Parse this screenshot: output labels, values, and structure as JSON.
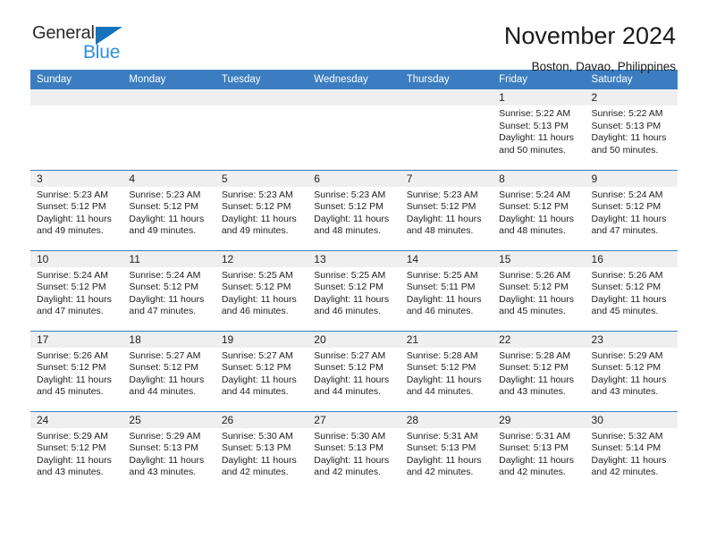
{
  "brand": {
    "name_part1": "General",
    "name_part2": "Blue",
    "triangle_icon": "triangle-icon",
    "accent_blue": "#2e8fd8",
    "dark_text": "#2b2b2b"
  },
  "header": {
    "title": "November 2024",
    "subtitle": "Boston, Davao, Philippines"
  },
  "colors": {
    "header_row_blue": "#3b7dc0",
    "daynum_strip": "#efefef",
    "cell_background": "#ffffff"
  },
  "calendar": {
    "weekdays": [
      "Sunday",
      "Monday",
      "Tuesday",
      "Wednesday",
      "Thursday",
      "Friday",
      "Saturday"
    ],
    "weeks": [
      [
        {
          "day": "",
          "empty": true,
          "sunrise": "",
          "sunset": "",
          "daylight1": "",
          "daylight2": ""
        },
        {
          "day": "",
          "empty": true,
          "sunrise": "",
          "sunset": "",
          "daylight1": "",
          "daylight2": ""
        },
        {
          "day": "",
          "empty": true,
          "sunrise": "",
          "sunset": "",
          "daylight1": "",
          "daylight2": ""
        },
        {
          "day": "",
          "empty": true,
          "sunrise": "",
          "sunset": "",
          "daylight1": "",
          "daylight2": ""
        },
        {
          "day": "",
          "empty": true,
          "sunrise": "",
          "sunset": "",
          "daylight1": "",
          "daylight2": ""
        },
        {
          "day": "1",
          "empty": false,
          "sunrise": "Sunrise: 5:22 AM",
          "sunset": "Sunset: 5:13 PM",
          "daylight1": "Daylight: 11 hours",
          "daylight2": "and 50 minutes."
        },
        {
          "day": "2",
          "empty": false,
          "sunrise": "Sunrise: 5:22 AM",
          "sunset": "Sunset: 5:13 PM",
          "daylight1": "Daylight: 11 hours",
          "daylight2": "and 50 minutes."
        }
      ],
      [
        {
          "day": "3",
          "empty": false,
          "sunrise": "Sunrise: 5:23 AM",
          "sunset": "Sunset: 5:12 PM",
          "daylight1": "Daylight: 11 hours",
          "daylight2": "and 49 minutes."
        },
        {
          "day": "4",
          "empty": false,
          "sunrise": "Sunrise: 5:23 AM",
          "sunset": "Sunset: 5:12 PM",
          "daylight1": "Daylight: 11 hours",
          "daylight2": "and 49 minutes."
        },
        {
          "day": "5",
          "empty": false,
          "sunrise": "Sunrise: 5:23 AM",
          "sunset": "Sunset: 5:12 PM",
          "daylight1": "Daylight: 11 hours",
          "daylight2": "and 49 minutes."
        },
        {
          "day": "6",
          "empty": false,
          "sunrise": "Sunrise: 5:23 AM",
          "sunset": "Sunset: 5:12 PM",
          "daylight1": "Daylight: 11 hours",
          "daylight2": "and 48 minutes."
        },
        {
          "day": "7",
          "empty": false,
          "sunrise": "Sunrise: 5:23 AM",
          "sunset": "Sunset: 5:12 PM",
          "daylight1": "Daylight: 11 hours",
          "daylight2": "and 48 minutes."
        },
        {
          "day": "8",
          "empty": false,
          "sunrise": "Sunrise: 5:24 AM",
          "sunset": "Sunset: 5:12 PM",
          "daylight1": "Daylight: 11 hours",
          "daylight2": "and 48 minutes."
        },
        {
          "day": "9",
          "empty": false,
          "sunrise": "Sunrise: 5:24 AM",
          "sunset": "Sunset: 5:12 PM",
          "daylight1": "Daylight: 11 hours",
          "daylight2": "and 47 minutes."
        }
      ],
      [
        {
          "day": "10",
          "empty": false,
          "sunrise": "Sunrise: 5:24 AM",
          "sunset": "Sunset: 5:12 PM",
          "daylight1": "Daylight: 11 hours",
          "daylight2": "and 47 minutes."
        },
        {
          "day": "11",
          "empty": false,
          "sunrise": "Sunrise: 5:24 AM",
          "sunset": "Sunset: 5:12 PM",
          "daylight1": "Daylight: 11 hours",
          "daylight2": "and 47 minutes."
        },
        {
          "day": "12",
          "empty": false,
          "sunrise": "Sunrise: 5:25 AM",
          "sunset": "Sunset: 5:12 PM",
          "daylight1": "Daylight: 11 hours",
          "daylight2": "and 46 minutes."
        },
        {
          "day": "13",
          "empty": false,
          "sunrise": "Sunrise: 5:25 AM",
          "sunset": "Sunset: 5:12 PM",
          "daylight1": "Daylight: 11 hours",
          "daylight2": "and 46 minutes."
        },
        {
          "day": "14",
          "empty": false,
          "sunrise": "Sunrise: 5:25 AM",
          "sunset": "Sunset: 5:11 PM",
          "daylight1": "Daylight: 11 hours",
          "daylight2": "and 46 minutes."
        },
        {
          "day": "15",
          "empty": false,
          "sunrise": "Sunrise: 5:26 AM",
          "sunset": "Sunset: 5:12 PM",
          "daylight1": "Daylight: 11 hours",
          "daylight2": "and 45 minutes."
        },
        {
          "day": "16",
          "empty": false,
          "sunrise": "Sunrise: 5:26 AM",
          "sunset": "Sunset: 5:12 PM",
          "daylight1": "Daylight: 11 hours",
          "daylight2": "and 45 minutes."
        }
      ],
      [
        {
          "day": "17",
          "empty": false,
          "sunrise": "Sunrise: 5:26 AM",
          "sunset": "Sunset: 5:12 PM",
          "daylight1": "Daylight: 11 hours",
          "daylight2": "and 45 minutes."
        },
        {
          "day": "18",
          "empty": false,
          "sunrise": "Sunrise: 5:27 AM",
          "sunset": "Sunset: 5:12 PM",
          "daylight1": "Daylight: 11 hours",
          "daylight2": "and 44 minutes."
        },
        {
          "day": "19",
          "empty": false,
          "sunrise": "Sunrise: 5:27 AM",
          "sunset": "Sunset: 5:12 PM",
          "daylight1": "Daylight: 11 hours",
          "daylight2": "and 44 minutes."
        },
        {
          "day": "20",
          "empty": false,
          "sunrise": "Sunrise: 5:27 AM",
          "sunset": "Sunset: 5:12 PM",
          "daylight1": "Daylight: 11 hours",
          "daylight2": "and 44 minutes."
        },
        {
          "day": "21",
          "empty": false,
          "sunrise": "Sunrise: 5:28 AM",
          "sunset": "Sunset: 5:12 PM",
          "daylight1": "Daylight: 11 hours",
          "daylight2": "and 44 minutes."
        },
        {
          "day": "22",
          "empty": false,
          "sunrise": "Sunrise: 5:28 AM",
          "sunset": "Sunset: 5:12 PM",
          "daylight1": "Daylight: 11 hours",
          "daylight2": "and 43 minutes."
        },
        {
          "day": "23",
          "empty": false,
          "sunrise": "Sunrise: 5:29 AM",
          "sunset": "Sunset: 5:12 PM",
          "daylight1": "Daylight: 11 hours",
          "daylight2": "and 43 minutes."
        }
      ],
      [
        {
          "day": "24",
          "empty": false,
          "sunrise": "Sunrise: 5:29 AM",
          "sunset": "Sunset: 5:12 PM",
          "daylight1": "Daylight: 11 hours",
          "daylight2": "and 43 minutes."
        },
        {
          "day": "25",
          "empty": false,
          "sunrise": "Sunrise: 5:29 AM",
          "sunset": "Sunset: 5:13 PM",
          "daylight1": "Daylight: 11 hours",
          "daylight2": "and 43 minutes."
        },
        {
          "day": "26",
          "empty": false,
          "sunrise": "Sunrise: 5:30 AM",
          "sunset": "Sunset: 5:13 PM",
          "daylight1": "Daylight: 11 hours",
          "daylight2": "and 42 minutes."
        },
        {
          "day": "27",
          "empty": false,
          "sunrise": "Sunrise: 5:30 AM",
          "sunset": "Sunset: 5:13 PM",
          "daylight1": "Daylight: 11 hours",
          "daylight2": "and 42 minutes."
        },
        {
          "day": "28",
          "empty": false,
          "sunrise": "Sunrise: 5:31 AM",
          "sunset": "Sunset: 5:13 PM",
          "daylight1": "Daylight: 11 hours",
          "daylight2": "and 42 minutes."
        },
        {
          "day": "29",
          "empty": false,
          "sunrise": "Sunrise: 5:31 AM",
          "sunset": "Sunset: 5:13 PM",
          "daylight1": "Daylight: 11 hours",
          "daylight2": "and 42 minutes."
        },
        {
          "day": "30",
          "empty": false,
          "sunrise": "Sunrise: 5:32 AM",
          "sunset": "Sunset: 5:14 PM",
          "daylight1": "Daylight: 11 hours",
          "daylight2": "and 42 minutes."
        }
      ]
    ]
  }
}
